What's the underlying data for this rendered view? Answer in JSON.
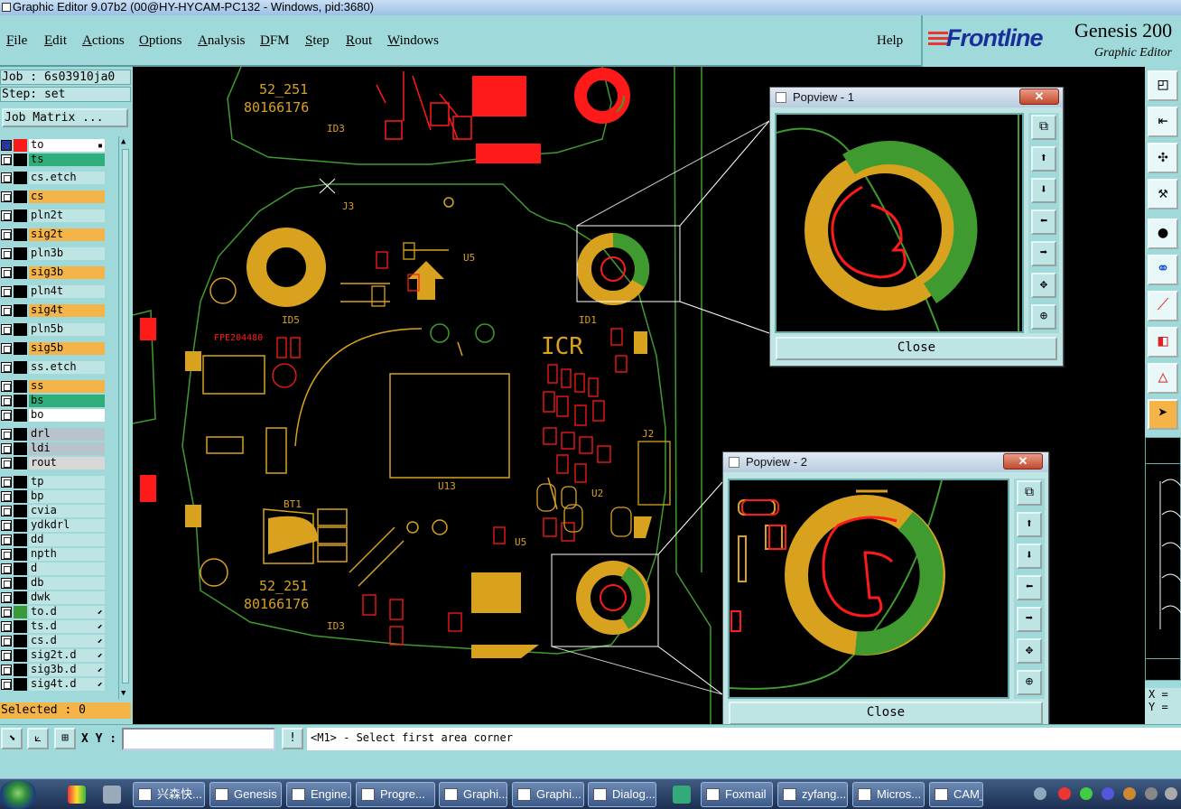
{
  "window": {
    "title": "Graphic Editor 9.07b2 (00@HY-HYCAM-PC132 - Windows, pid:3680)"
  },
  "menu": {
    "items": [
      {
        "label": "File",
        "u": "F",
        "rest": "ile"
      },
      {
        "label": "Edit",
        "u": "E",
        "rest": "dit"
      },
      {
        "label": "Actions",
        "u": "A",
        "rest": "ctions"
      },
      {
        "label": "Options",
        "u": "O",
        "rest": "ptions"
      },
      {
        "label": "Analysis",
        "u": "A",
        "rest": "nalysis"
      },
      {
        "label": "DFM",
        "u": "D",
        "rest": "FM"
      },
      {
        "label": "Step",
        "u": "S",
        "rest": "tep"
      },
      {
        "label": "Rout",
        "u": "R",
        "rest": "out"
      },
      {
        "label": "Windows",
        "u": "W",
        "rest": "indows"
      }
    ],
    "help": "Help"
  },
  "brand": {
    "company": "Frontline",
    "product": "Genesis 200",
    "module": "Graphic Editor"
  },
  "job": {
    "job_line": "Job : 6s03910ja0",
    "step_line": "Step: set",
    "matrix_label": "Job Matrix ...",
    "selected_line": "Selected : 0"
  },
  "layers": [
    {
      "name": "to",
      "bg": "#ffffff",
      "swatch": "#ff1a1a",
      "mark": "▪",
      "checked": true
    },
    {
      "name": "ts",
      "bg": "#2fae7c",
      "swatch": "",
      "mark": ""
    },
    {
      "name": "cs.etch",
      "bg": "#bfe4e4",
      "swatch": "",
      "mark": ""
    },
    {
      "name": "cs",
      "bg": "#f5b447",
      "swatch": "",
      "mark": ""
    },
    {
      "name": "pln2t",
      "bg": "#bfe4e4",
      "swatch": "",
      "mark": ""
    },
    {
      "name": "sig2t",
      "bg": "#f5b447",
      "swatch": "",
      "mark": ""
    },
    {
      "name": "pln3b",
      "bg": "#bfe4e4",
      "swatch": "",
      "mark": ""
    },
    {
      "name": "sig3b",
      "bg": "#f5b447",
      "swatch": "",
      "mark": ""
    },
    {
      "name": "pln4t",
      "bg": "#bfe4e4",
      "swatch": "",
      "mark": ""
    },
    {
      "name": "sig4t",
      "bg": "#f5b447",
      "swatch": "",
      "mark": ""
    },
    {
      "name": "pln5b",
      "bg": "#bfe4e4",
      "swatch": "",
      "mark": ""
    },
    {
      "name": "sig5b",
      "bg": "#f5b447",
      "swatch": "",
      "mark": ""
    },
    {
      "name": "ss.etch",
      "bg": "#bfe4e4",
      "swatch": "",
      "mark": ""
    },
    {
      "name": "ss",
      "bg": "#f5b447",
      "swatch": "",
      "mark": ""
    },
    {
      "name": "bs",
      "bg": "#2fae7c",
      "swatch": "",
      "mark": ""
    },
    {
      "name": "bo",
      "bg": "#ffffff",
      "swatch": "",
      "mark": ""
    },
    {
      "name": "drl",
      "bg": "#b8c4cc",
      "swatch": "",
      "mark": ""
    },
    {
      "name": "ldi",
      "bg": "#b8c4cc",
      "swatch": "",
      "mark": ""
    },
    {
      "name": "rout",
      "bg": "#d8d8d8",
      "swatch": "",
      "mark": ""
    },
    {
      "name": "tp",
      "bg": "#bfe4e4",
      "swatch": "",
      "mark": ""
    },
    {
      "name": "bp",
      "bg": "#bfe4e4",
      "swatch": "",
      "mark": ""
    },
    {
      "name": "cvia",
      "bg": "#bfe4e4",
      "swatch": "",
      "mark": ""
    },
    {
      "name": "ydkdrl",
      "bg": "#bfe4e4",
      "swatch": "",
      "mark": ""
    },
    {
      "name": "dd",
      "bg": "#bfe4e4",
      "swatch": "",
      "mark": ""
    },
    {
      "name": "npth",
      "bg": "#bfe4e4",
      "swatch": "",
      "mark": ""
    },
    {
      "name": "d",
      "bg": "#bfe4e4",
      "swatch": "",
      "mark": ""
    },
    {
      "name": "db",
      "bg": "#bfe4e4",
      "swatch": "",
      "mark": ""
    },
    {
      "name": "dwk",
      "bg": "#bfe4e4",
      "swatch": "",
      "mark": ""
    },
    {
      "name": "to.d",
      "bg": "#bfe4e4",
      "swatch": "#3a9a3a",
      "mark": "⬋"
    },
    {
      "name": "ts.d",
      "bg": "#bfe4e4",
      "swatch": "",
      "mark": "⬋"
    },
    {
      "name": "cs.d",
      "bg": "#bfe4e4",
      "swatch": "",
      "mark": "⬋"
    },
    {
      "name": "sig2t.d",
      "bg": "#bfe4e4",
      "swatch": "",
      "mark": "⬋"
    },
    {
      "name": "sig3b.d",
      "bg": "#bfe4e4",
      "swatch": "",
      "mark": "⬋"
    },
    {
      "name": "sig4t.d",
      "bg": "#bfe4e4",
      "swatch": "",
      "mark": "⬋"
    }
  ],
  "board": {
    "labels": [
      "52_251",
      "80166176",
      "ID3",
      "J3",
      "U5",
      "ID5",
      "ID1",
      "FPE204480",
      "ICR",
      "U13",
      "J2",
      "U2",
      "BT1",
      "52_251",
      "80166176",
      "ID3",
      "U5"
    ],
    "colors": {
      "trace": "#d8a21f",
      "copper_red": "#ff1a1a",
      "outline_green": "#3f9a2f",
      "white": "#ffffff"
    }
  },
  "popviews": [
    {
      "title": "Popview - 1",
      "close_x": "✕",
      "close_label": "Close"
    },
    {
      "title": "Popview - 2",
      "close_x": "✕",
      "close_label": "Close"
    }
  ],
  "status": {
    "xy_label": "X Y :",
    "xy_value": "",
    "prompt": "<M1> - Select first area corner",
    "xy_readout_x": "X =",
    "xy_readout_y": "Y ="
  },
  "taskbar": {
    "buttons": [
      "兴森快...",
      "Genesis",
      "Engine...",
      "Progre...",
      "Graphi...",
      "Graphi...",
      "Dialog...",
      "Foxmail",
      "zyfang...",
      "Micros...",
      "CAM_..."
    ]
  }
}
